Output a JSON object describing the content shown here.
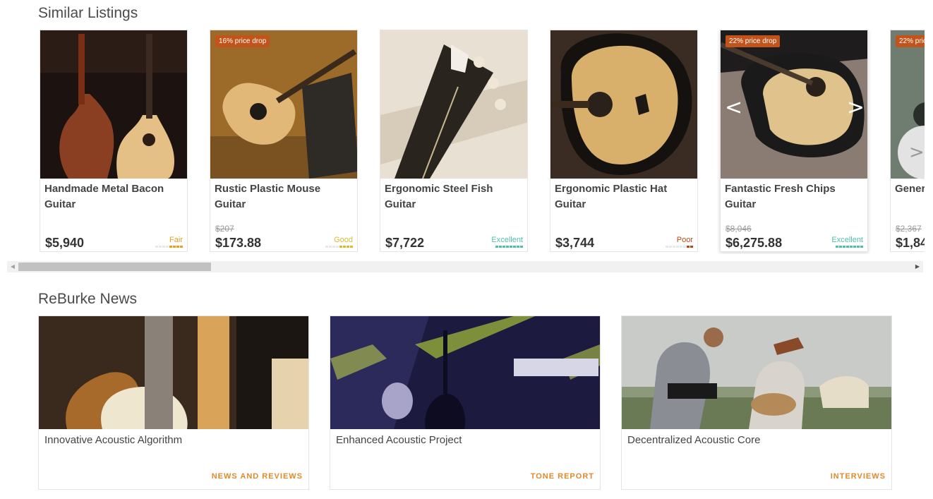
{
  "similar": {
    "title": "Similar Listings",
    "cards": [
      {
        "title": "Handmade Metal Bacon Guitar",
        "badge": "",
        "old_price": "",
        "price": "$5,940",
        "condition": "Fair",
        "condition_color": "#e4a11b"
      },
      {
        "title": "Rustic Plastic Mouse Guitar",
        "badge": "16% price drop",
        "old_price": "$207",
        "price": "$173.88",
        "condition": "Good",
        "condition_color": "#e0b92a"
      },
      {
        "title": "Ergonomic Steel Fish Guitar",
        "badge": "",
        "old_price": "",
        "price": "$7,722",
        "condition": "Excellent",
        "condition_color": "#4fbfa8"
      },
      {
        "title": "Ergonomic Plastic Hat Guitar",
        "badge": "",
        "old_price": "",
        "price": "$3,744",
        "condition": "Poor",
        "condition_color": "#b8480f"
      },
      {
        "title": "Fantastic Fresh Chips Guitar",
        "badge": "22% price drop",
        "old_price": "$8,046",
        "price": "$6,275.88",
        "condition": "Excellent",
        "condition_color": "#4fbfa8"
      },
      {
        "title": "Gener",
        "badge": "22% pric",
        "old_price": "$2,367",
        "price": "$1,84",
        "condition": "",
        "condition_color": "#4fbfa8"
      }
    ],
    "prev_glyph": "<",
    "next_glyph": ">",
    "next_button_glyph": ">"
  },
  "scrollbar": {
    "left_glyph": "◀",
    "right_glyph": "▶"
  },
  "news": {
    "title": "ReBurke News",
    "items": [
      {
        "title": "Innovative Acoustic Algorithm",
        "category": "NEWS AND REVIEWS"
      },
      {
        "title": "Enhanced Acoustic Project",
        "category": "TONE REPORT"
      },
      {
        "title": "Decentralized Acoustic Core",
        "category": "INTERVIEWS"
      }
    ]
  },
  "colors": {
    "accent": "#e0892b",
    "badge": "#c2541b",
    "excellent": "#4fbfa8",
    "fair": "#e4a11b",
    "good": "#e0b92a",
    "poor": "#b8480f"
  }
}
